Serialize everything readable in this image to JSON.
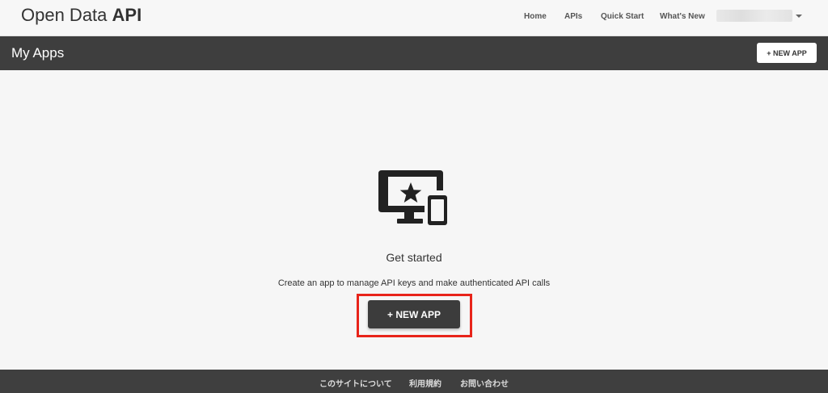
{
  "topnav": {
    "brand_light": "Open Data",
    "brand_bold": "API",
    "links": [
      "Home",
      "APIs",
      "Quick Start",
      "What's New"
    ]
  },
  "header": {
    "title": "My Apps",
    "new_app_label": "+ NEW APP"
  },
  "main": {
    "icon": "desktop-star-mobile-icon",
    "heading": "Get started",
    "description": "Create an app to manage API keys and make authenticated API calls",
    "new_app_label": "+ NEW APP"
  },
  "footer": {
    "links": [
      "このサイトについて",
      "利用規約",
      "お問い合わせ"
    ]
  },
  "colors": {
    "header_band": "#3e3e3e",
    "footer": "#3f3f3f",
    "button_dark": "#3c3c3c",
    "highlight": "#e8241a",
    "background": "#f6f6f6"
  }
}
